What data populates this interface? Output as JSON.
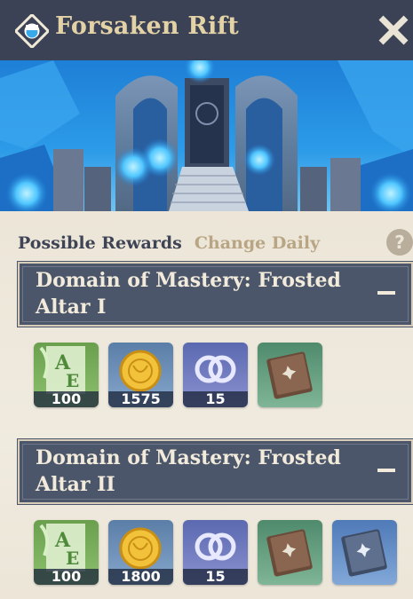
{
  "header": {
    "title": "Forsaken Rift",
    "icon": "domain-diamond-icon",
    "close_icon": "close-icon",
    "background": "#3b4255",
    "title_color": "#e3d2a6"
  },
  "rewards": {
    "label": "Possible Rewards",
    "note": "Change Daily",
    "help": "?"
  },
  "sections": [
    {
      "title": "Domain of Mastery: Frosted Altar I",
      "items": [
        {
          "icon": "adventure-exp-icon",
          "count": "100"
        },
        {
          "icon": "mora-icon",
          "count": "1575"
        },
        {
          "icon": "companionship-exp-icon",
          "count": "15"
        },
        {
          "icon": "talent-book-green-icon",
          "count": ""
        }
      ]
    },
    {
      "title": "Domain of Mastery: Frosted Altar II",
      "items": [
        {
          "icon": "adventure-exp-icon",
          "count": "100"
        },
        {
          "icon": "mora-icon",
          "count": "1800"
        },
        {
          "icon": "companionship-exp-icon",
          "count": "15"
        },
        {
          "icon": "talent-book-green-icon",
          "count": ""
        },
        {
          "icon": "talent-book-blue-icon",
          "count": ""
        }
      ]
    }
  ]
}
